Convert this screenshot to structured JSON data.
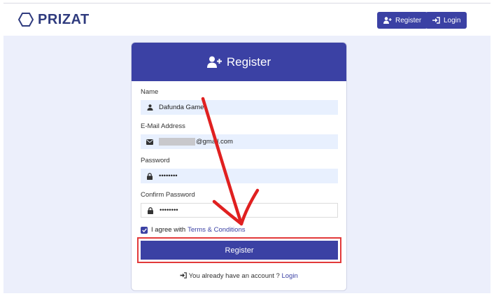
{
  "brand": {
    "name": "PRIZAT"
  },
  "nav": {
    "register_label": "Register",
    "login_label": "Login"
  },
  "card": {
    "title": "Register"
  },
  "form": {
    "name_label": "Name",
    "name_value": "Dafunda Game",
    "email_label": "E-Mail Address",
    "email_value": "@gmail.com",
    "password_label": "Password",
    "password_value": "••••••••",
    "confirm_label": "Confirm Password",
    "confirm_value": "••••••••",
    "agree_text": "I agree with",
    "terms_link": "Terms & Conditions",
    "submit_label": "Register"
  },
  "footer": {
    "question": "You already have an account ?",
    "login_link": "Login"
  },
  "colors": {
    "primary": "#3b41a4",
    "highlight": "#e23a3a",
    "annotation_arrow": "#e02020"
  }
}
